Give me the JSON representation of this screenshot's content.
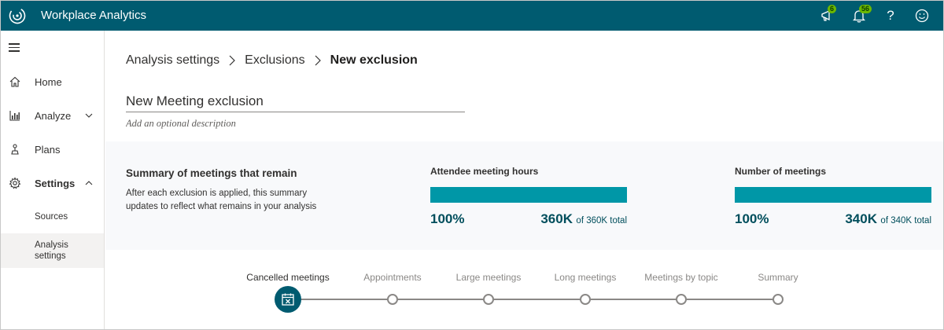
{
  "app": {
    "title": "Workplace Analytics"
  },
  "topbar": {
    "announcements_badge": "6",
    "notifications_badge": "56",
    "help_label": "?"
  },
  "sidebar": {
    "items": [
      {
        "label": "Home",
        "icon": "home-icon"
      },
      {
        "label": "Analyze",
        "icon": "chart-icon"
      },
      {
        "label": "Plans",
        "icon": "plans-icon"
      },
      {
        "label": "Settings",
        "icon": "gear-icon"
      }
    ],
    "subitems": [
      {
        "label": "Sources"
      },
      {
        "label": "Analysis settings"
      }
    ]
  },
  "breadcrumb": {
    "items": [
      "Analysis settings",
      "Exclusions"
    ],
    "current": "New exclusion"
  },
  "form": {
    "title_value": "New Meeting exclusion",
    "description_placeholder": "Add an optional description"
  },
  "summary": {
    "title": "Summary of meetings that remain",
    "description": "After each exclusion is applied, this summary updates to reflect what remains in your analysis",
    "metrics": [
      {
        "title": "Attendee meeting hours",
        "percent": "100%",
        "value": "360K",
        "of_total": "of 360K total",
        "fill": 1.0
      },
      {
        "title": "Number of meetings",
        "percent": "100%",
        "value": "340K",
        "of_total": "of 340K total",
        "fill": 1.0
      }
    ],
    "accent_color": "#0097a7"
  },
  "stepper": {
    "steps": [
      "Cancelled meetings",
      "Appointments",
      "Large meetings",
      "Long meetings",
      "Meetings by topic",
      "Summary"
    ],
    "active_index": 0,
    "active_icon": "calendar-cancel-icon"
  },
  "colors": {
    "header": "#005b70",
    "badge": "#6bb700"
  }
}
